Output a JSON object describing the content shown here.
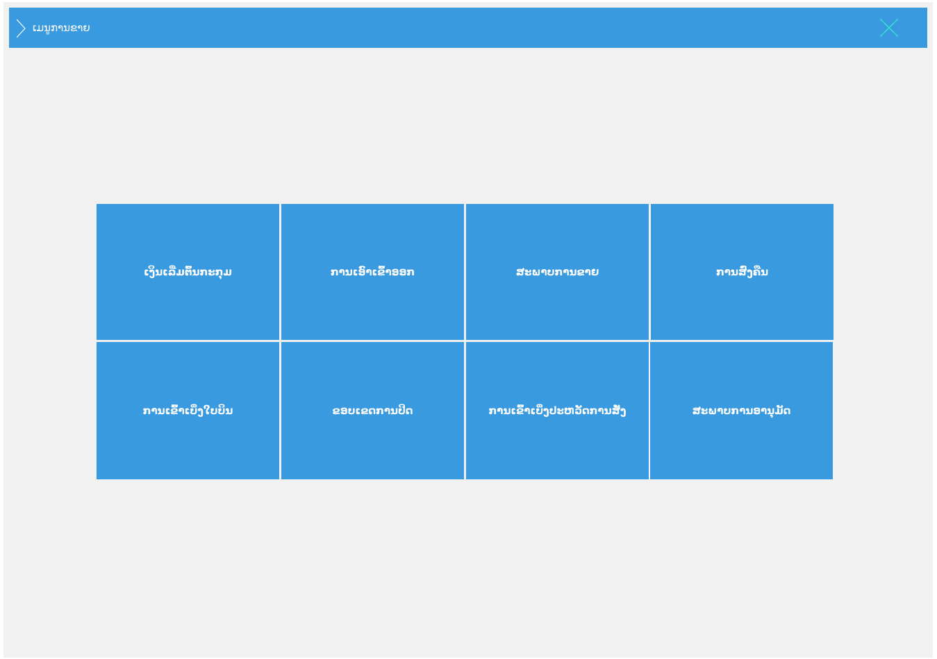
{
  "header": {
    "title": "ເມນູການຂາຍ",
    "chevron_icon": "chevron-right-icon",
    "close_icon": "close-icon"
  },
  "colors": {
    "header_bg": "#3a9ae0",
    "tile_bg": "#3a9ae0",
    "page_bg": "#f1f1f1",
    "close_icon": "#38e0d0"
  },
  "menu": {
    "tiles": [
      {
        "label": "ເງິນເລີ່ມຕົ້ນກະກຸມ"
      },
      {
        "label": "ການເອົາເຂົ້າອອກ"
      },
      {
        "label": "ສະພາບການຂາຍ"
      },
      {
        "label": "ການສົ່ງຄືນ"
      },
      {
        "label": "ການເຂົ້າເບິ່ງໃບບິນ"
      },
      {
        "label": "ຂອບເຂດການປິດ"
      },
      {
        "label": "ການເຂົ້າເບິ່ງປະຫວັດການສັ່ງ"
      },
      {
        "label": "ສະພາບການອານຸມັດ"
      }
    ]
  }
}
